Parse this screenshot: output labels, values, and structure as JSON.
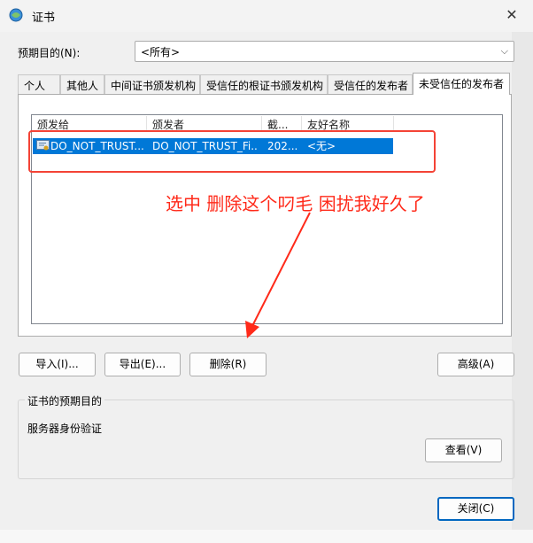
{
  "window": {
    "title": "证书"
  },
  "purpose_row": {
    "label": "预期目的(N):",
    "value": "<所有>"
  },
  "tabs": [
    {
      "label": "个人"
    },
    {
      "label": "其他人"
    },
    {
      "label": "中间证书颁发机构"
    },
    {
      "label": "受信任的根证书颁发机构"
    },
    {
      "label": "受信任的发布者"
    },
    {
      "label": "未受信任的发布者"
    }
  ],
  "active_tab": "未受信任的发布者",
  "columns": [
    "颁发给",
    "颁发者",
    "截...",
    "友好名称"
  ],
  "rows": [
    {
      "issued_to": "DO_NOT_TRUST...",
      "issuer": "DO_NOT_TRUST_Fi...",
      "expiry": "202...",
      "friendly_name": "<无>",
      "selected": true
    }
  ],
  "annotation": {
    "text": "选中 删除这个叼毛 困扰我好久了",
    "color": "#ff2a1a"
  },
  "buttons": {
    "import": "导入(I)...",
    "export": "导出(E)...",
    "remove": "删除(R)",
    "advanced": "高级(A)",
    "view": "查看(V)",
    "close": "关闭(C)"
  },
  "cert_purposes": {
    "title": "证书的预期目的",
    "value": "服务器身份验证"
  },
  "colors": {
    "selection": "#0078d7",
    "accent": "#0067c0",
    "annotation": "#f44336"
  }
}
